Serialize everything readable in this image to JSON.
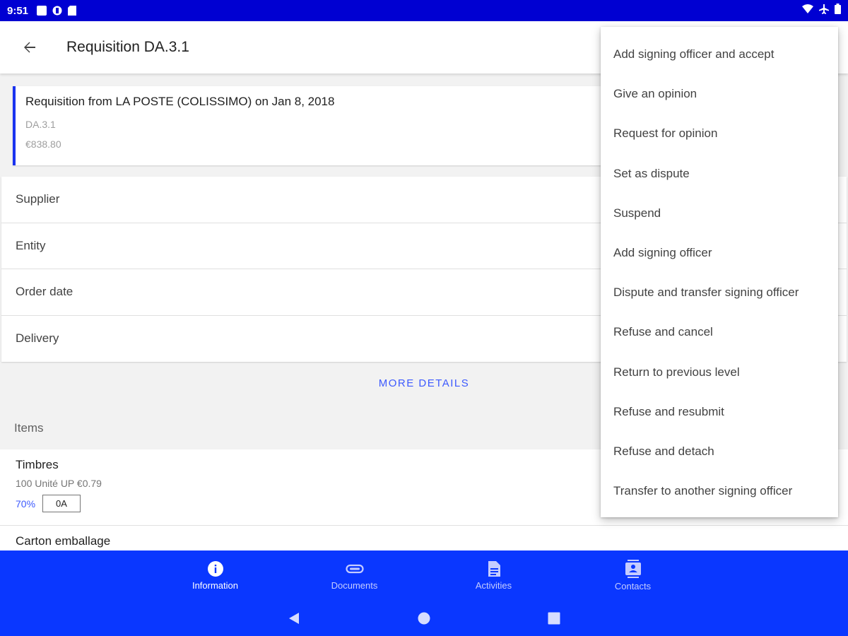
{
  "status_bar": {
    "time": "9:51"
  },
  "app_bar": {
    "title": "Requisition DA.3.1"
  },
  "summary": {
    "title": "Requisition from LA POSTE (COLISSIMO) on Jan 8, 2018",
    "reference": "DA.3.1",
    "amount": "€838.80",
    "accent_color": "#1a33f0"
  },
  "fields": [
    {
      "label": "Supplier"
    },
    {
      "label": "Entity"
    },
    {
      "label": "Order date"
    },
    {
      "label": "Delivery"
    }
  ],
  "more_details_label": "MORE DETAILS",
  "items_label": "Items",
  "items": [
    {
      "name": "Timbres",
      "meta": "100 Unité  UP €0.79",
      "percent": "70%",
      "tag": "0A"
    },
    {
      "name": "Carton emballage"
    }
  ],
  "menu": {
    "items": [
      "Add signing officer and accept",
      "Give an opinion",
      "Request for opinion",
      "Set as dispute",
      "Suspend",
      "Add signing officer",
      "Dispute and transfer signing officer",
      "Refuse and cancel",
      "Return to previous level",
      "Refuse and resubmit",
      "Refuse and detach",
      "Transfer to another signing officer"
    ]
  },
  "bottom_nav": {
    "items": [
      {
        "label": "Information",
        "icon": "info-icon",
        "active": true
      },
      {
        "label": "Documents",
        "icon": "attachment-icon",
        "active": false
      },
      {
        "label": "Activities",
        "icon": "document-icon",
        "active": false
      },
      {
        "label": "Contacts",
        "icon": "contacts-icon",
        "active": false
      }
    ],
    "background": "#0a37ff"
  },
  "status_bar_color": "#0000d2"
}
